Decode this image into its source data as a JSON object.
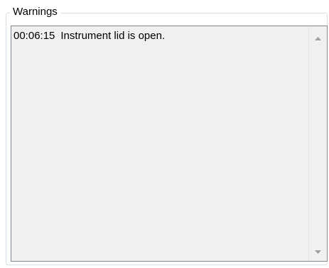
{
  "group": {
    "title": "Warnings"
  },
  "warnings": [
    {
      "time": "00:06:15",
      "message": "Instrument lid is open."
    }
  ],
  "scrollbar": {
    "up_icon": "chevron-up-icon",
    "down_icon": "chevron-down-icon"
  }
}
